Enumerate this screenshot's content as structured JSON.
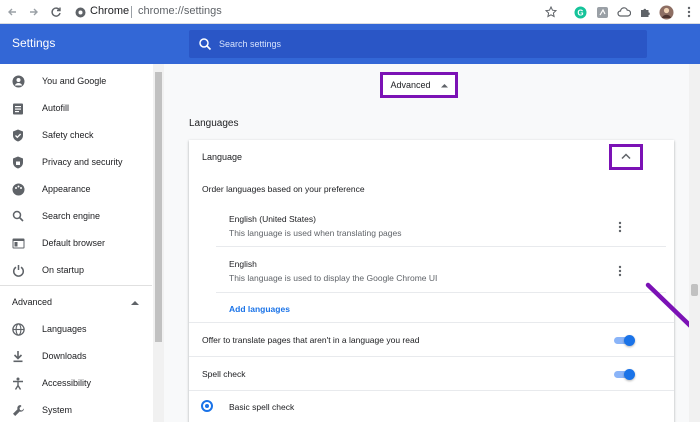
{
  "browser": {
    "site_name": "Chrome",
    "url": "chrome://settings",
    "icons": [
      "back-icon",
      "forward-icon",
      "reload-icon",
      "site-info-icon",
      "star-icon",
      "grammarly-icon",
      "extension-icon",
      "cloud-icon",
      "puzzle-icon",
      "profile-avatar",
      "menu-icon"
    ]
  },
  "header": {
    "title": "Settings",
    "search_placeholder": "Search settings"
  },
  "sidebar": {
    "items": [
      {
        "label": "You and Google",
        "icon": "person-icon"
      },
      {
        "label": "Autofill",
        "icon": "clipboard-icon"
      },
      {
        "label": "Safety check",
        "icon": "shield-icon"
      },
      {
        "label": "Privacy and security",
        "icon": "shield-lock-icon"
      },
      {
        "label": "Appearance",
        "icon": "palette-icon"
      },
      {
        "label": "Search engine",
        "icon": "search-icon"
      },
      {
        "label": "Default browser",
        "icon": "browser-icon"
      },
      {
        "label": "On startup",
        "icon": "power-icon"
      }
    ],
    "advanced_label": "Advanced",
    "advanced_items": [
      {
        "label": "Languages",
        "icon": "globe-icon"
      },
      {
        "label": "Downloads",
        "icon": "download-icon"
      },
      {
        "label": "Accessibility",
        "icon": "accessibility-icon"
      },
      {
        "label": "System",
        "icon": "wrench-icon"
      }
    ]
  },
  "main": {
    "advanced_button": "Advanced",
    "section_title": "Languages",
    "card": {
      "title": "Language",
      "order_text": "Order languages based on your preference",
      "languages": [
        {
          "name": "English (United States)",
          "desc": "This language is used when translating pages"
        },
        {
          "name": "English",
          "desc": "This language is used to display the Google Chrome UI"
        }
      ],
      "add_languages": "Add languages",
      "offer_translate": "Offer to translate pages that aren't in a language you read",
      "spell_check": "Spell check",
      "basic_spell_check": "Basic spell check"
    },
    "offer_translate_on": true,
    "spell_check_on": true
  },
  "colors": {
    "header_blue": "#3367d6",
    "accent_blue": "#1a73e8",
    "annotation_purple": "#7b12b5"
  }
}
